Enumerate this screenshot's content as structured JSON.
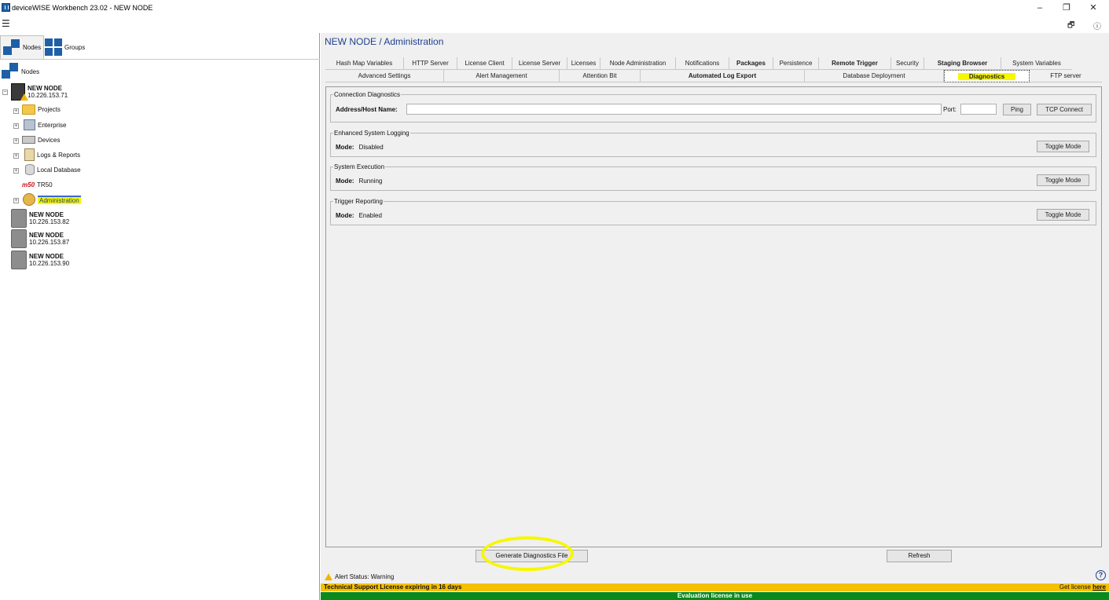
{
  "window": {
    "title": "deviceWISE Workbench 23.02  -  NEW NODE",
    "minimize": "–",
    "restore": "❐",
    "close": "✕",
    "menu_icon": "☰",
    "restore_icon2": "🗗",
    "info_icon": "ⓘ"
  },
  "left": {
    "tabs": [
      {
        "label": "Nodes",
        "icon": "nodes-icon"
      },
      {
        "label": "Groups",
        "icon": "groups-icon"
      }
    ],
    "root_label": "Nodes",
    "node1": {
      "name": "NEW NODE",
      "ip": "10.226.153.71"
    },
    "children": [
      {
        "label": "Projects",
        "icon": "folder-icon"
      },
      {
        "label": "Enterprise",
        "icon": "enterprise-icon"
      },
      {
        "label": "Devices",
        "icon": "devices-icon"
      },
      {
        "label": "Logs & Reports",
        "icon": "logs-icon"
      },
      {
        "label": "Local Database",
        "icon": "database-icon"
      },
      {
        "label": "TR50",
        "logo": "m50"
      },
      {
        "label": "Administration",
        "icon": "admin-icon"
      }
    ],
    "other_nodes": [
      {
        "name": "NEW NODE",
        "ip": "10.226.153.82"
      },
      {
        "name": "NEW NODE",
        "ip": "10.226.153.87"
      },
      {
        "name": "NEW NODE",
        "ip": "10.226.153.90"
      }
    ]
  },
  "right": {
    "breadcrumb": "NEW NODE / Administration",
    "tabs_row1": [
      "Hash Map Variables",
      "HTTP Server",
      "License Client",
      "License Server",
      "Licenses",
      "Node Administration",
      "Notifications",
      "Packages",
      "Persistence",
      "Remote Trigger",
      "Security",
      "Staging Browser",
      "System Variables"
    ],
    "tabs_row2": [
      "Advanced Settings",
      "Alert Management",
      "Attention Bit",
      "Automated Log Export",
      "Database Deployment",
      "Diagnostics",
      "FTP server"
    ],
    "active_tab": "Diagnostics",
    "connection": {
      "title": "Connection Diagnostics",
      "address_label": "Address/Host Name:",
      "address_value": "",
      "port_label": "Port:",
      "port_value": "",
      "ping": "Ping",
      "tcp": "TCP Connect"
    },
    "sections": [
      {
        "title": "Enhanced System Logging",
        "mode_label": "Mode:",
        "mode_value": "Disabled",
        "button": "Toggle Mode"
      },
      {
        "title": "System Execution",
        "mode_label": "Mode:",
        "mode_value": "Running",
        "button": "Toggle Mode"
      },
      {
        "title": "Trigger Reporting",
        "mode_label": "Mode:",
        "mode_value": "Enabled",
        "button": "Toggle Mode"
      }
    ],
    "generate_button": "Generate Diagnostics File",
    "refresh_button": "Refresh",
    "alert_status": "Alert Status: Warning",
    "license_warning": "Technical Support License expiring in 16 days",
    "get_license_prefix": "Get license ",
    "get_license_link": "here",
    "evaluation": "Evaluation license in use",
    "colors": {
      "highlight": "#f7f700",
      "license_bar": "#f5c000",
      "eval_bar": "#0a8a1a",
      "accent": "#1f3f8f"
    }
  }
}
